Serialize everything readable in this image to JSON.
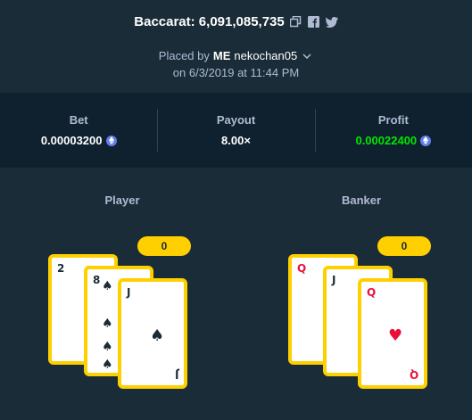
{
  "header": {
    "title": "Baccarat: 6,091,085,735",
    "placed_prefix": "Placed by",
    "user_badge": "ME",
    "username": "nekochan05",
    "date": "on 6/3/2019 at 11:44 PM"
  },
  "icons": {
    "copy": "copy-icon",
    "facebook": "facebook-icon",
    "twitter": "twitter-icon",
    "chevron": "chevron-down-icon",
    "currency": "eth-icon"
  },
  "stats": {
    "bet_label": "Bet",
    "bet_value": "0.00003200",
    "payout_label": "Payout",
    "payout_value": "8.00×",
    "profit_label": "Profit",
    "profit_value": "0.00022400"
  },
  "player": {
    "label": "Player",
    "score": "0",
    "cards": [
      {
        "rank": "2",
        "suit": "♠",
        "color": "black"
      },
      {
        "rank": "8",
        "suit": "♠",
        "color": "black"
      },
      {
        "rank": "J",
        "suit": "♠",
        "color": "black"
      }
    ]
  },
  "banker": {
    "label": "Banker",
    "score": "0",
    "cards": [
      {
        "rank": "Q",
        "suit": "♥",
        "color": "red"
      },
      {
        "rank": "J",
        "suit": "♠",
        "color": "black"
      },
      {
        "rank": "Q",
        "suit": "♥",
        "color": "red"
      }
    ]
  },
  "colors": {
    "background": "#1a2c38",
    "panel": "#0f212e",
    "accent": "#ffd000",
    "profit": "#00e701",
    "muted": "#b1bad3",
    "red_suit": "#e9113c"
  }
}
